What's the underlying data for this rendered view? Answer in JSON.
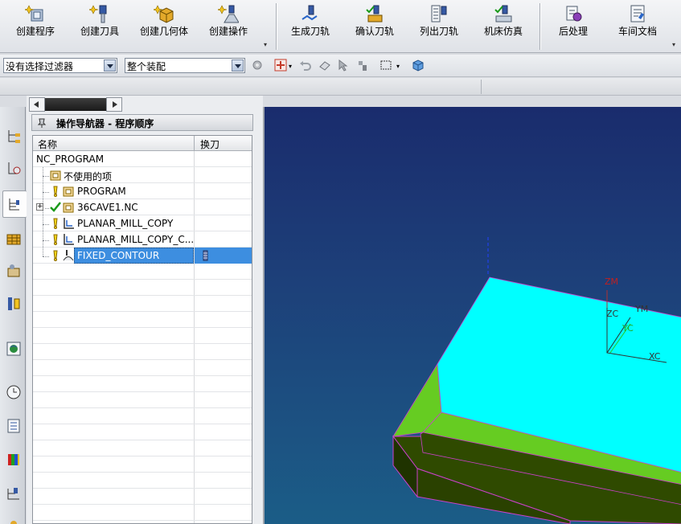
{
  "ribbon": {
    "group1": [
      {
        "label": "创建程序",
        "icon": "create-program-icon"
      },
      {
        "label": "创建刀具",
        "icon": "create-tool-icon"
      },
      {
        "label": "创建几何体",
        "icon": "create-geometry-icon"
      },
      {
        "label": "创建操作",
        "icon": "create-operation-icon"
      }
    ],
    "group2": [
      {
        "label": "生成刀轨",
        "icon": "generate-toolpath-icon"
      },
      {
        "label": "确认刀轨",
        "icon": "verify-toolpath-icon"
      },
      {
        "label": "列出刀轨",
        "icon": "list-toolpath-icon"
      },
      {
        "label": "机床仿真",
        "icon": "machine-simulation-icon"
      }
    ],
    "group3": [
      {
        "label": "后处理",
        "icon": "postprocess-icon"
      },
      {
        "label": "车间文档",
        "icon": "shop-documentation-icon"
      }
    ]
  },
  "filterbar": {
    "selection_filter": "没有选择过滤器",
    "scope": "整个装配"
  },
  "navigator": {
    "title": "操作导航器 - 程序顺序",
    "col_name": "名称",
    "col_toolchange": "换刀",
    "rows": [
      {
        "name": "NC_PROGRAM",
        "level": 0
      },
      {
        "name": "不使用的项",
        "level": 1
      },
      {
        "name": "PROGRAM",
        "level": 1
      },
      {
        "name": "36CAVE1.NC",
        "level": 1
      },
      {
        "name": "PLANAR_MILL_COPY",
        "level": 1
      },
      {
        "name": "PLANAR_MILL_COPY_C...",
        "level": 1
      },
      {
        "name": "FIXED_CONTOUR",
        "level": 1,
        "selected": true
      }
    ]
  },
  "viewport": {
    "axes": {
      "zm": "ZM",
      "zc": "ZC",
      "ym": "YM",
      "yc": "YC",
      "xc": "XC"
    }
  },
  "colors": {
    "part_top": "#00ffff",
    "part_side": "#2f4a00",
    "part_chamfer": "#66cc22",
    "selection": "#3d8ee0",
    "viewport_top": "#1a2c6d",
    "viewport_bottom": "#1b5d87"
  }
}
